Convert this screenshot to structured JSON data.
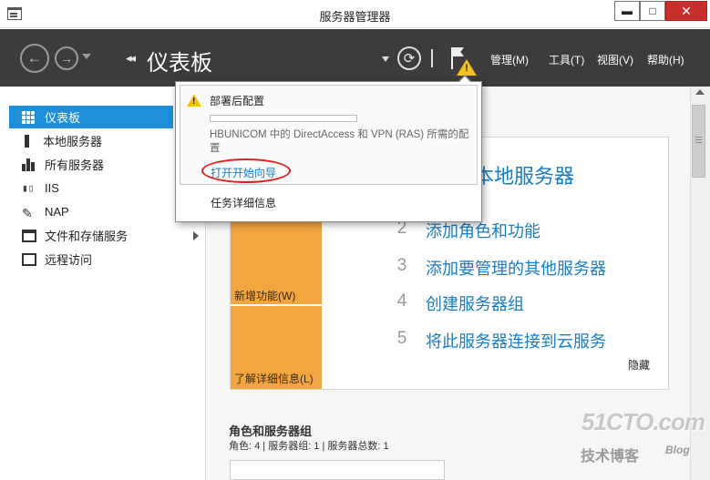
{
  "window": {
    "title": "服务器管理器",
    "minimize": "▬",
    "maximize": "□",
    "close": "✕"
  },
  "header": {
    "breadcrumb_arrows": "◂◂",
    "page_title": "仪表板",
    "back_glyph": "←",
    "forward_glyph": "→",
    "refresh_glyph": "⟳",
    "menus": [
      "管理(M)",
      "工具(T)",
      "视图(V)",
      "帮助(H)"
    ]
  },
  "sidebar": {
    "items": [
      {
        "label": "仪表板",
        "icon": "dashboard-icon"
      },
      {
        "label": "本地服务器",
        "icon": "server-icon"
      },
      {
        "label": "所有服务器",
        "icon": "servers-icon"
      },
      {
        "label": "IIS",
        "icon": "iis-icon"
      },
      {
        "label": "NAP",
        "icon": "nap-icon"
      },
      {
        "label": "文件和存储服务",
        "icon": "file-storage-icon"
      },
      {
        "label": "远程访问",
        "icon": "remote-access-icon"
      }
    ]
  },
  "notification": {
    "title": "部署后配置",
    "description": "HBUNICOM 中的 DirectAccess 和 VPN (RAS) 所需的配置",
    "link": "打开开始向导",
    "details": "任务详细信息"
  },
  "welcome": {
    "heading": "本地服务器",
    "steps": [
      {
        "num": "2",
        "text": "添加角色和功能"
      },
      {
        "num": "3",
        "text": "添加要管理的其他服务器"
      },
      {
        "num": "4",
        "text": "创建服务器组"
      },
      {
        "num": "5",
        "text": "将此服务器连接到云服务"
      }
    ],
    "whats_new": "新增功能(W)",
    "learn_more": "了解详细信息(L)",
    "hide": "隐藏"
  },
  "roles": {
    "title": "角色和服务器组",
    "subtitle": "角色: 4 | 服务器组: 1 | 服务器总数: 1"
  },
  "watermark": {
    "main": "51CTO.com",
    "sub": "技术博客",
    "blog": "Blog"
  },
  "colors": {
    "accent": "#1e8fd8",
    "header_bg": "#3c3c3c",
    "tile_orange": "#f3a640",
    "link_blue": "#1a7dc1",
    "warning_yellow": "#f4c01e",
    "highlight_red": "#e0201f"
  }
}
